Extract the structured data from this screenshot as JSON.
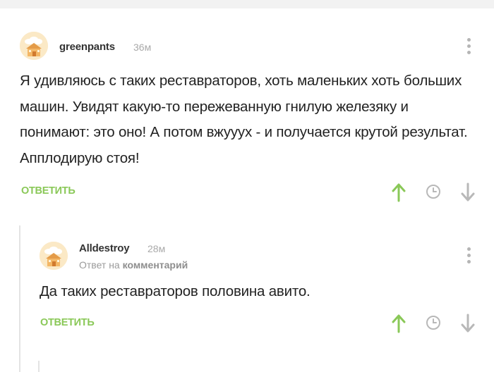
{
  "comments": [
    {
      "username": "greenpants",
      "time": "36м",
      "text": "Я удивляюсь с таких реставраторов, хоть маленьких хоть больших машин. Увидят какую-то пережеванную гнилую железяку и понимают: это оно! А потом вжууух - и получается крутой результат. Апплодирую стоя!",
      "reply_label": "ОТВЕТИТЬ"
    },
    {
      "username": "Alldestroy",
      "time": "28м",
      "reply_to_prefix": "Ответ на",
      "reply_to_target": "комментарий",
      "text": "Да таких реставраторов половина авито.",
      "reply_label": "ОТВЕТИТЬ"
    }
  ],
  "colors": {
    "accent_green": "#8ac858",
    "muted_gray": "#a9a9a9"
  },
  "icons": [
    "avatar",
    "more-vertical-icon",
    "arrow-up-icon",
    "clock-icon",
    "arrow-down-icon"
  ]
}
